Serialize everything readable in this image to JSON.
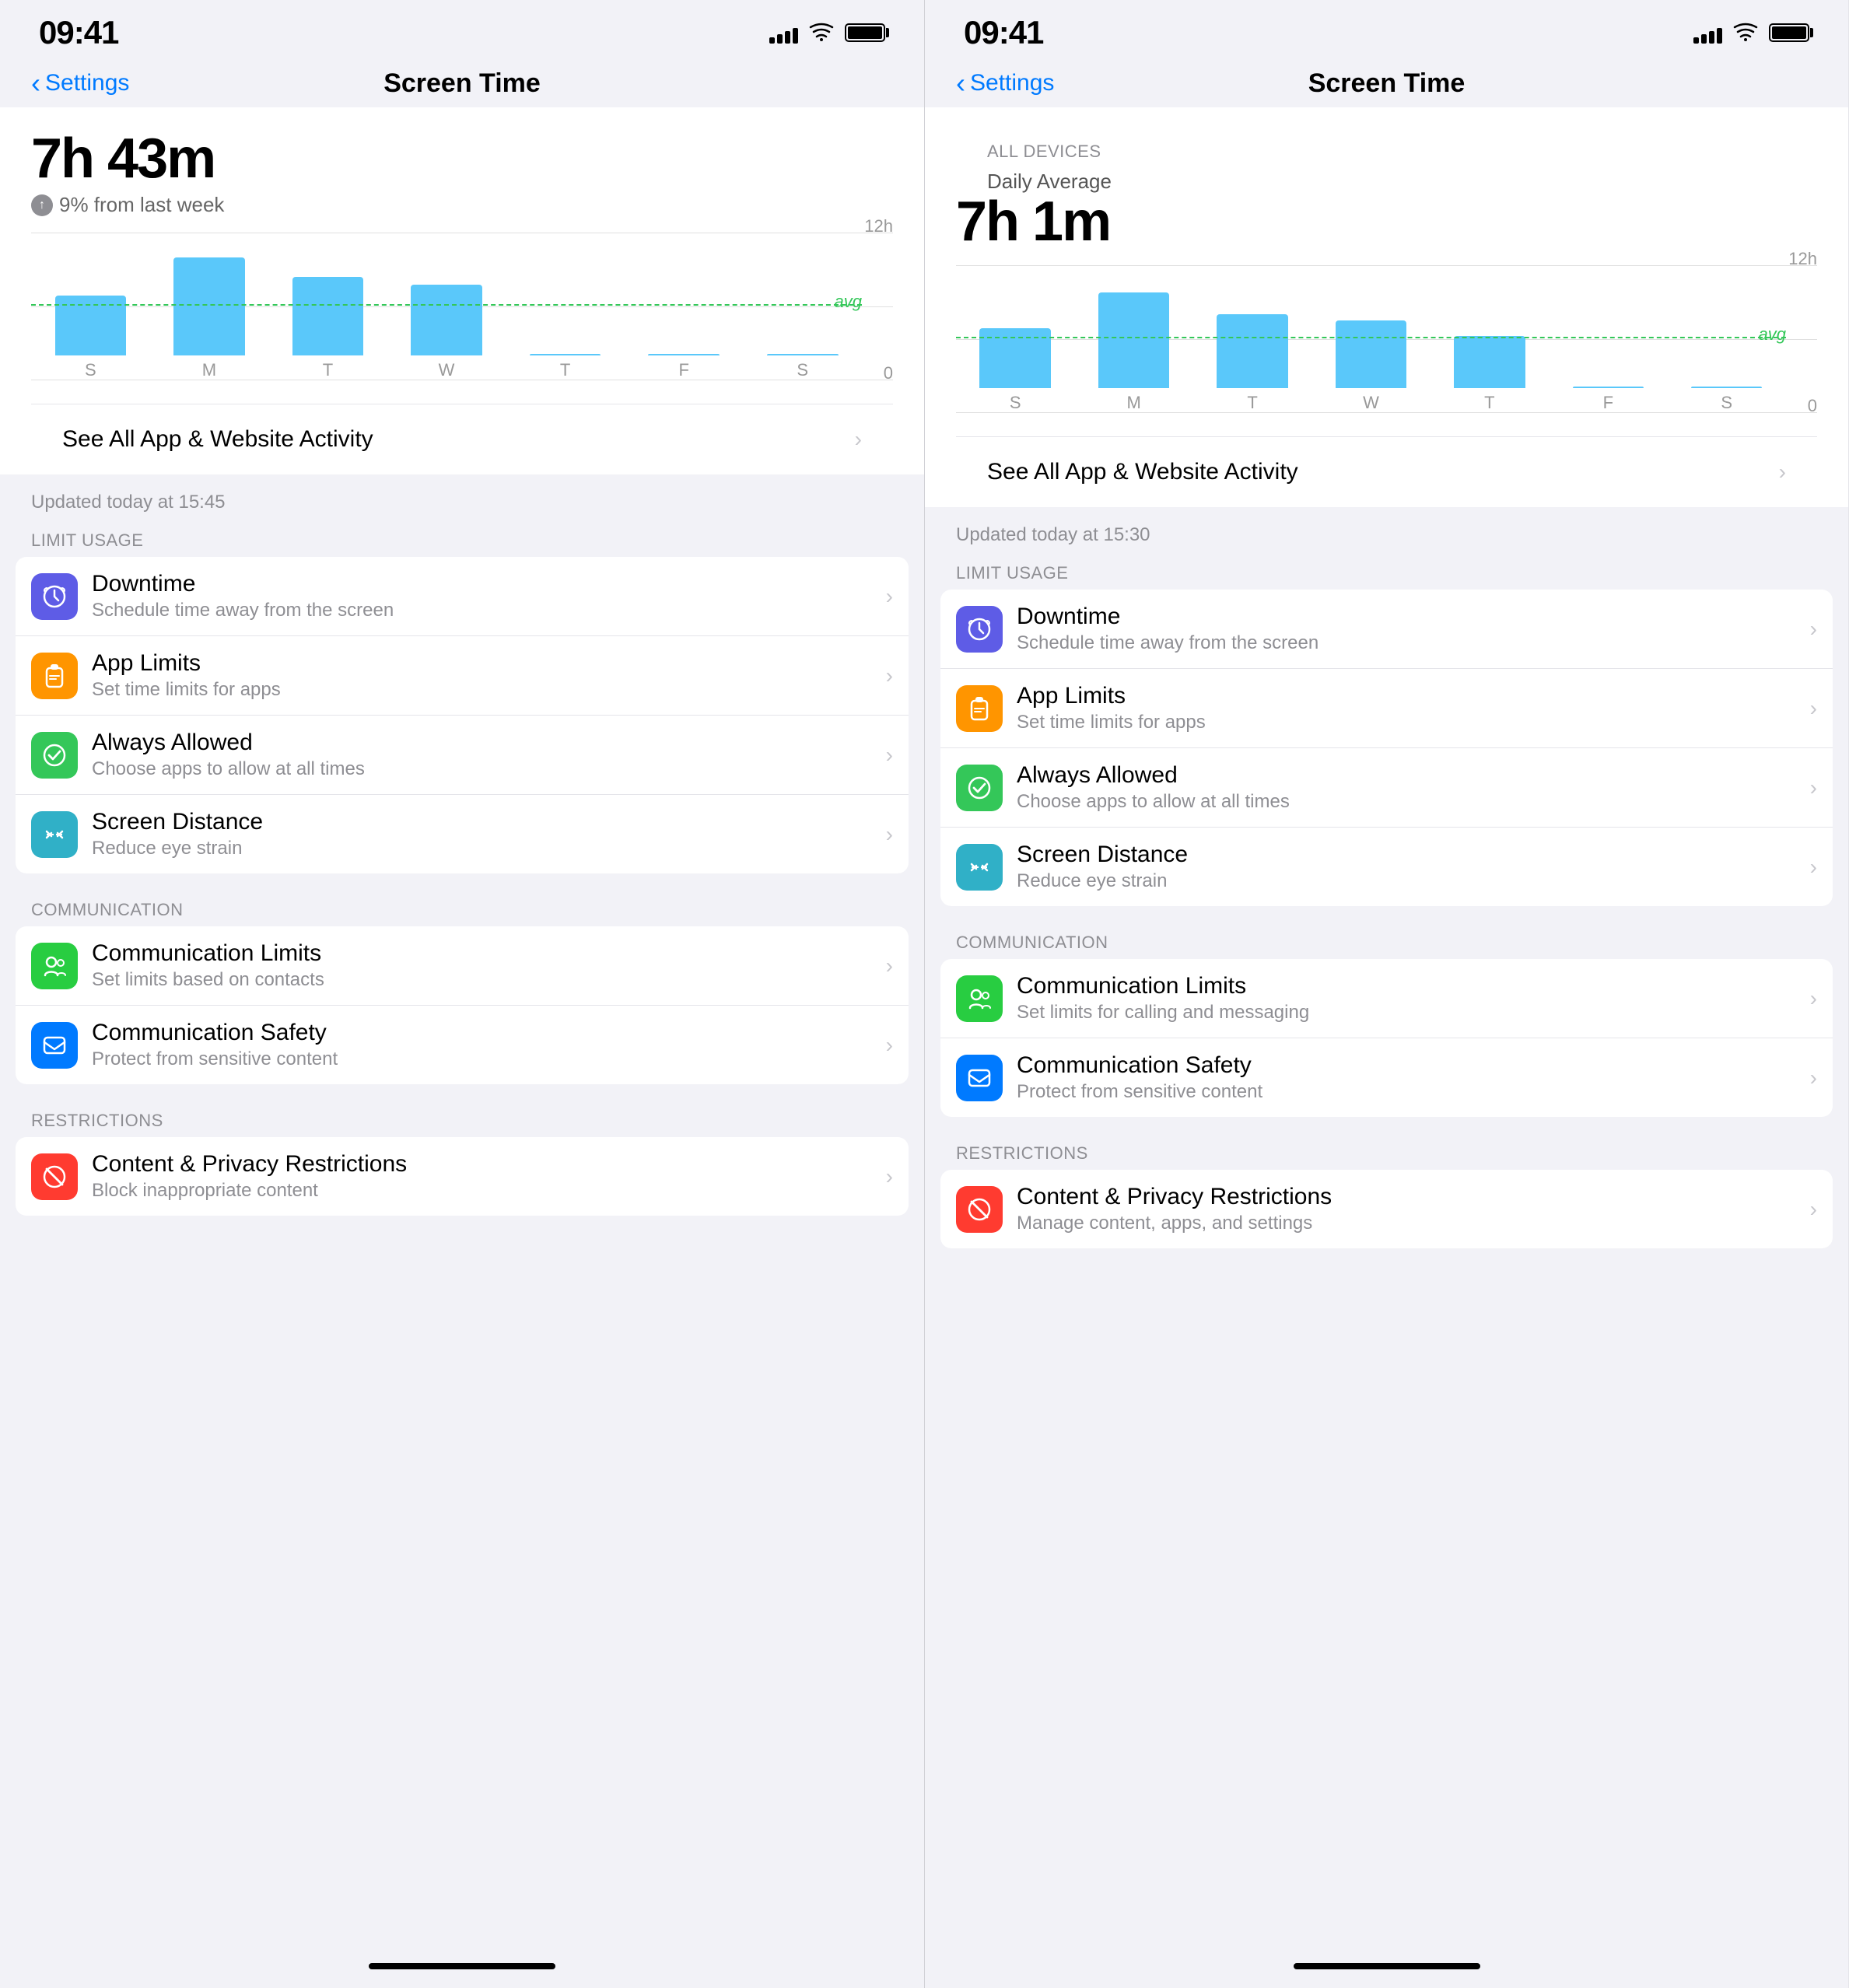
{
  "panels": [
    {
      "id": "left",
      "statusBar": {
        "time": "09:41",
        "signal": [
          6,
          10,
          14,
          18,
          22
        ],
        "battery": 100
      },
      "navBar": {
        "backLabel": "Settings",
        "title": "Screen Time"
      },
      "usage": {
        "bigTime": "7h 43m",
        "trend": "9% from last week",
        "trendUp": true
      },
      "chart": {
        "yMax": "12h",
        "yZero": "0",
        "avgLabel": "avg",
        "bars": [
          {
            "day": "S",
            "height": 55
          },
          {
            "day": "M",
            "height": 90
          },
          {
            "day": "T",
            "height": 72
          },
          {
            "day": "W",
            "height": 65
          },
          {
            "day": "T",
            "height": 0
          },
          {
            "day": "F",
            "height": 0
          },
          {
            "day": "S",
            "height": 0
          }
        ]
      },
      "seeAll": "See All App & Website Activity",
      "updatedText": "Updated today at 15:45",
      "allDevices": null,
      "dailyAvg": null,
      "sections": [
        {
          "label": "LIMIT USAGE",
          "rows": [
            {
              "icon": "downtime",
              "iconColor": "icon-purple",
              "title": "Downtime",
              "subtitle": "Schedule time away from the screen"
            },
            {
              "icon": "applimits",
              "iconColor": "icon-orange",
              "title": "App Limits",
              "subtitle": "Set time limits for apps"
            },
            {
              "icon": "alwaysallowed",
              "iconColor": "icon-green",
              "title": "Always Allowed",
              "subtitle": "Choose apps to allow at all times"
            },
            {
              "icon": "screendistance",
              "iconColor": "icon-blue-light",
              "title": "Screen Distance",
              "subtitle": "Reduce eye strain"
            }
          ]
        },
        {
          "label": "COMMUNICATION",
          "rows": [
            {
              "icon": "commlimits",
              "iconColor": "icon-green-dark",
              "title": "Communication Limits",
              "subtitle": "Set limits based on contacts"
            },
            {
              "icon": "commsafety",
              "iconColor": "icon-blue",
              "title": "Communication Safety",
              "subtitle": "Protect from sensitive content"
            }
          ]
        },
        {
          "label": "RESTRICTIONS",
          "rows": [
            {
              "icon": "contentprivacy",
              "iconColor": "icon-red",
              "title": "Content & Privacy Restrictions",
              "subtitle": "Block inappropriate content"
            }
          ]
        }
      ]
    },
    {
      "id": "right",
      "statusBar": {
        "time": "09:41",
        "signal": [
          6,
          10,
          14,
          18,
          22
        ],
        "battery": 100
      },
      "navBar": {
        "backLabel": "Settings",
        "title": "Screen Time"
      },
      "usage": {
        "bigTime": "7h 1m",
        "trend": null,
        "trendUp": false
      },
      "chart": {
        "yMax": "12h",
        "yZero": "0",
        "avgLabel": "avg",
        "bars": [
          {
            "day": "S",
            "height": 55
          },
          {
            "day": "M",
            "height": 88
          },
          {
            "day": "T",
            "height": 68
          },
          {
            "day": "W",
            "height": 62
          },
          {
            "day": "T",
            "height": 48
          },
          {
            "day": "F",
            "height": 0
          },
          {
            "day": "S",
            "height": 0
          }
        ]
      },
      "seeAll": "See All App & Website Activity",
      "updatedText": "Updated today at 15:30",
      "allDevices": "ALL DEVICES",
      "dailyAvg": "Daily Average",
      "sections": [
        {
          "label": "LIMIT USAGE",
          "rows": [
            {
              "icon": "downtime",
              "iconColor": "icon-purple",
              "title": "Downtime",
              "subtitle": "Schedule time away from the screen"
            },
            {
              "icon": "applimits",
              "iconColor": "icon-orange",
              "title": "App Limits",
              "subtitle": "Set time limits for apps"
            },
            {
              "icon": "alwaysallowed",
              "iconColor": "icon-green",
              "title": "Always Allowed",
              "subtitle": "Choose apps to allow at all times"
            },
            {
              "icon": "screendistance",
              "iconColor": "icon-blue-light",
              "title": "Screen Distance",
              "subtitle": "Reduce eye strain"
            }
          ]
        },
        {
          "label": "COMMUNICATION",
          "rows": [
            {
              "icon": "commlimits",
              "iconColor": "icon-green-dark",
              "title": "Communication Limits",
              "subtitle": "Set limits for calling and messaging"
            },
            {
              "icon": "commsafety",
              "iconColor": "icon-blue",
              "title": "Communication Safety",
              "subtitle": "Protect from sensitive content"
            }
          ]
        },
        {
          "label": "RESTRICTIONS",
          "rows": [
            {
              "icon": "contentprivacy",
              "iconColor": "icon-red",
              "title": "Content & Privacy Restrictions",
              "subtitle": "Manage content, apps, and settings"
            }
          ]
        }
      ]
    }
  ]
}
